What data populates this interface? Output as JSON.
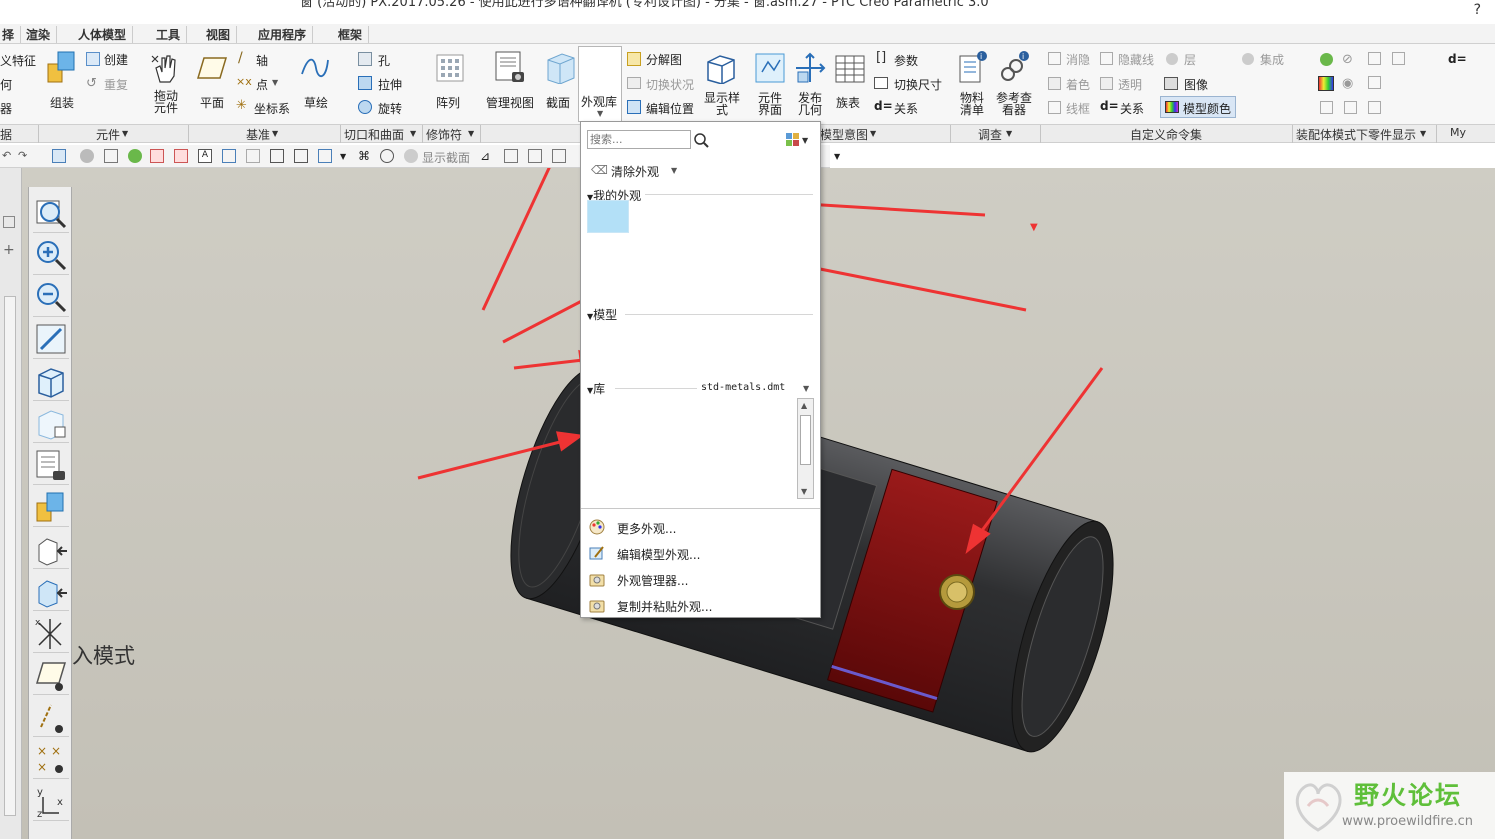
{
  "title": {
    "text": "窗 (活动的) PX.2017.05.26 - 使用此进行多语种翻译机 (专利设计图) - 分集 - 窗.asm.27 - PTC Creo Parametric 3.0"
  },
  "menubar": [
    "择",
    "渲染",
    "人体模型",
    "工具",
    "视图",
    "应用程序",
    "框架"
  ],
  "ribbon": {
    "left_partial": [
      "义特征",
      "何",
      "器"
    ],
    "assemble_label": "组装",
    "create_label": "创建",
    "repeat_label": "重复",
    "drag_label": "拖动元件",
    "plane_label": "平面",
    "axis_label": "轴",
    "point_label": "点",
    "csys_label": "坐标系",
    "sketch_label": "草绘",
    "hole_label": "孔",
    "extrude_label": "拉伸",
    "revolve_label": "旋转",
    "pattern_label": "阵列",
    "manage_views_label": "管理视图",
    "section_label": "截面",
    "appearance_gallery_label": "外观库",
    "exploded_view_label": "分解图",
    "toggle_status_label": "切换状况",
    "edit_position_label": "编辑位置",
    "display_style_label": "显示样式",
    "component_interface_label": "元件界面",
    "publish_geometry_label": "发布几何",
    "family_table_label": "族表",
    "parameters_label": "参数",
    "switch_dims_label": "切换尺寸",
    "relations_label": "关系",
    "bom_label": "物料清单",
    "ref_viewer_label": "参考查看器",
    "hide_label": "消隐",
    "hidden_line_label": "隐藏线",
    "layer_label": "层",
    "integrate_label": "集成",
    "shade_label": "着色",
    "transparent_label": "透明",
    "image_label": "图像",
    "wireframe_label": "线框",
    "relations2_label": "关系",
    "model_color_label": "模型颜色",
    "d_eq": "d="
  },
  "groups": [
    "据",
    "元件",
    "基准",
    "切口和曲面",
    "修饰符",
    "模型意图",
    "调查",
    "自定义命令集",
    "装配体模式下零件显示",
    "My"
  ],
  "quick_toolbar": {
    "show_section": "显示截面"
  },
  "popup": {
    "search_placeholder": "搜索...",
    "clear_appearance": "清除外观",
    "my_appearances": "我的外观",
    "model": "模型",
    "library": "库",
    "library_file": "std-metals.dmt",
    "more_appearances": "更多外观...",
    "edit_model_appearance": "编辑模型外观...",
    "appearance_manager": "外观管理器...",
    "copy_paste_appearance": "复制并粘贴外观..."
  },
  "viewport": {
    "mode_text": "入模式"
  },
  "watermark": {
    "name": "野火论坛",
    "url": "www.proewildfire.cn"
  },
  "colors": {
    "swatch": "#b3e0f7",
    "arrow": "#ee3333",
    "cylinder_dark": "#3a3b3d",
    "cylinder_red": "#7a1010",
    "watermark_green": "#5fbf3a"
  }
}
